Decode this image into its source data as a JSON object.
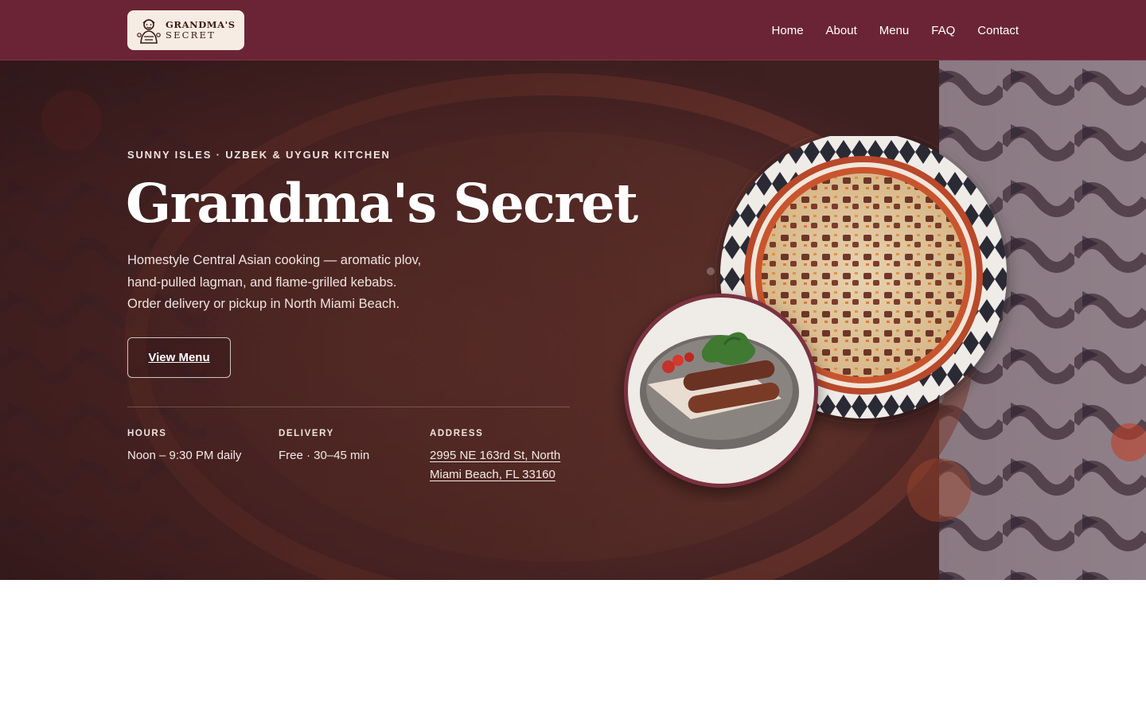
{
  "header": {
    "logo": {
      "line1": "GRANDMA'S",
      "line2": "SECRET"
    },
    "nav": [
      {
        "label": "Home"
      },
      {
        "label": "About"
      },
      {
        "label": "Menu"
      },
      {
        "label": "FAQ"
      },
      {
        "label": "Contact"
      }
    ]
  },
  "hero": {
    "eyebrow": "SUNNY ISLES · UZBEK & UYGUR KITCHEN",
    "title": "Grandma's Secret",
    "description_lines": [
      "Homestyle Central Asian cooking — aromatic plov,",
      "hand-pulled lagman, and flame-grilled kebabs.",
      "Order delivery or pickup in North Miami Beach."
    ],
    "cta_label": "View Menu",
    "info": {
      "hours": {
        "label": "HOURS",
        "value": "Noon – 9:30 PM daily"
      },
      "delivery": {
        "label": "DELIVERY",
        "value": "Free · 30–45 min"
      },
      "address": {
        "label": "ADDRESS",
        "line1": "2995 NE 163rd St, North",
        "line2": "Miami Beach, FL 33160"
      }
    }
  },
  "colors": {
    "header_bg": "#6a2436",
    "logo_bg": "#f6ece3",
    "hero_tint": "#4d2727"
  },
  "icons": [
    "grandma-logo-icon"
  ]
}
